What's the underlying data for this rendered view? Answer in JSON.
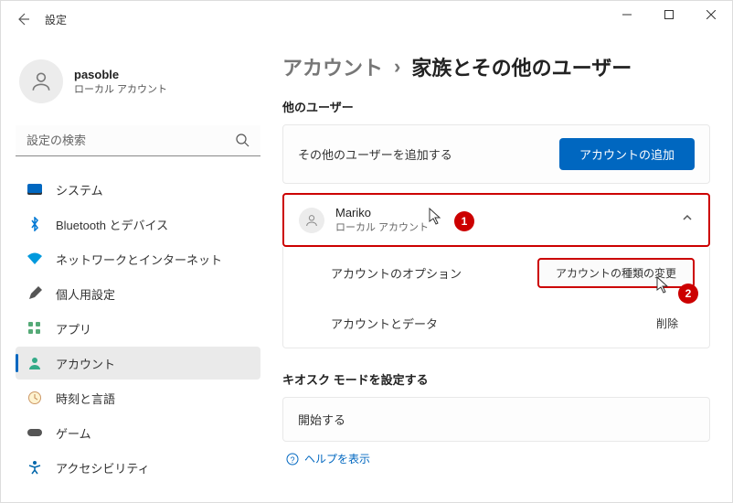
{
  "window": {
    "title": "設定"
  },
  "user": {
    "name": "pasoble",
    "type": "ローカル アカウント"
  },
  "search": {
    "placeholder": "設定の検索"
  },
  "sidebar": {
    "items": [
      {
        "label": "システム"
      },
      {
        "label": "Bluetooth とデバイス"
      },
      {
        "label": "ネットワークとインターネット"
      },
      {
        "label": "個人用設定"
      },
      {
        "label": "アプリ"
      },
      {
        "label": "アカウント"
      },
      {
        "label": "時刻と言語"
      },
      {
        "label": "ゲーム"
      },
      {
        "label": "アクセシビリティ"
      }
    ],
    "active_index": 5
  },
  "breadcrumb": {
    "parent": "アカウント",
    "sep": "›",
    "current": "家族とその他のユーザー"
  },
  "sections": {
    "other_users_title": "他のユーザー",
    "add_other_text": "その他のユーザーを追加する",
    "add_button": "アカウントの追加",
    "kiosk_title": "キオスク モードを設定する",
    "kiosk_start": "開始する",
    "help_link": "ヘルプを表示"
  },
  "other_user": {
    "name": "Mariko",
    "sub": "ローカル アカウント",
    "option_label": "アカウントのオプション",
    "change_type_btn": "アカウントの種類の変更",
    "data_label": "アカウントとデータ",
    "delete_btn": "削除"
  },
  "callouts": {
    "one": "1",
    "two": "2"
  }
}
